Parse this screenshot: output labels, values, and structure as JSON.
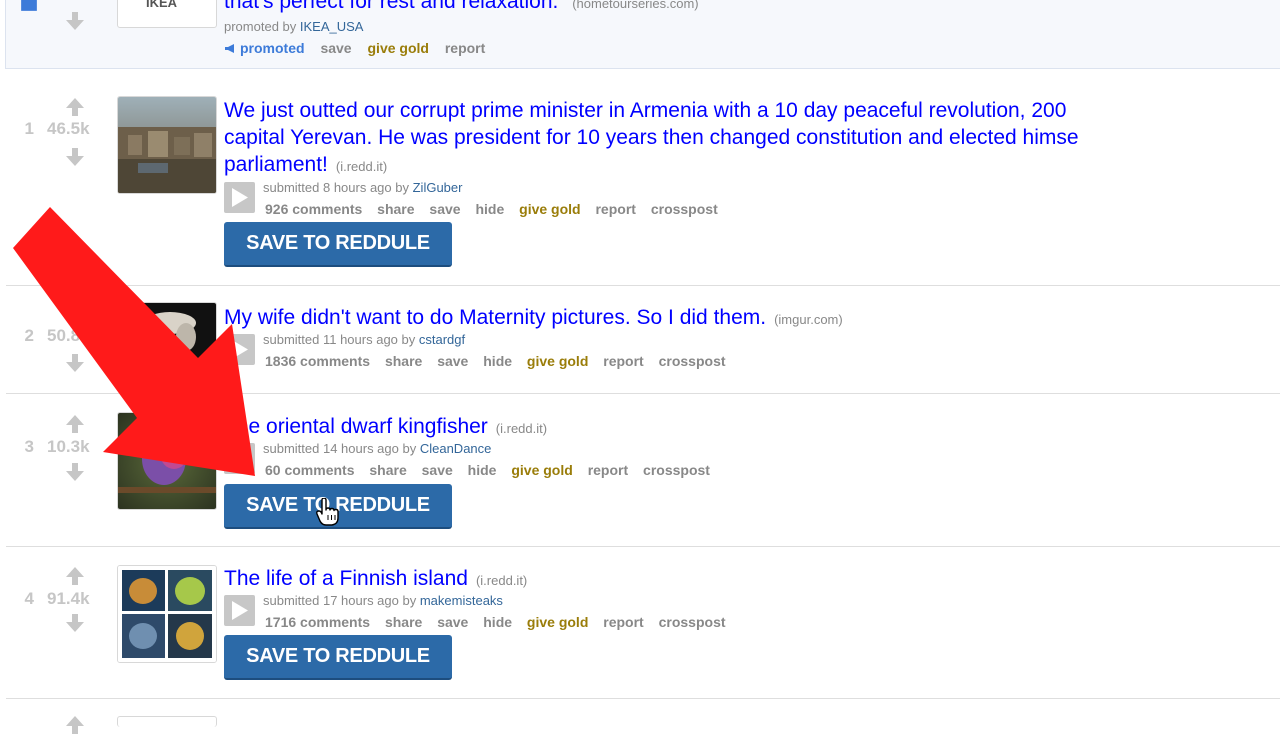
{
  "promoted_post": {
    "title_tail": "that's perfect for rest and relaxation.",
    "domain": "(hometourseries.com)",
    "promoted_by_prefix": "promoted by",
    "promoted_by_user": "IKEA_USA",
    "thumb_text": "IKEA",
    "buttons": {
      "promoted": "promoted",
      "save": "save",
      "give_gold": "give gold",
      "report": "report"
    }
  },
  "posts": [
    {
      "rank": "1",
      "score": "46.5k",
      "title_line1": "We just outted our corrupt prime minister in Armenia with a 10 day peaceful revolution, 200",
      "title_line2": "capital Yerevan. He was president for 10 years then changed constitution and elected himse",
      "title_line3": "parliament!",
      "domain": "(i.redd.it)",
      "submitted": "submitted 8 hours ago by",
      "user": "ZilGuber",
      "comments": "926 comments",
      "save_reddule": "SAVE TO REDDULE"
    },
    {
      "rank": "2",
      "score": "50.8k",
      "title": "My wife didn't want to do Maternity pictures. So I did them.",
      "domain": "(imgur.com)",
      "submitted": "submitted 11 hours ago by",
      "user": "cstardgf",
      "comments": "1836 comments"
    },
    {
      "rank": "3",
      "score": "10.3k",
      "title": "The oriental dwarf kingfisher",
      "domain": "(i.redd.it)",
      "submitted": "submitted 14 hours ago by",
      "user": "CleanDance",
      "comments": "60 comments",
      "save_reddule": "SAVE TO REDDULE"
    },
    {
      "rank": "4",
      "score": "91.4k",
      "title": "The life of a Finnish island",
      "domain": "(i.redd.it)",
      "submitted": "submitted 17 hours ago by",
      "user": "makemisteaks",
      "comments": "1716 comments",
      "save_reddule": "SAVE TO REDDULE"
    }
  ],
  "post_buttons": {
    "share": "share",
    "save": "save",
    "hide": "hide",
    "give_gold": "give gold",
    "report": "report",
    "crosspost": "crosspost"
  },
  "colors": {
    "link": "#0000ff",
    "reddule_button": "#2c6aa8",
    "annotation_arrow": "#ff1a1a",
    "gold": "#9a7d0a"
  },
  "icons": [
    "upvote-arrow-icon",
    "downvote-arrow-icon",
    "expando-play-icon",
    "megaphone-icon",
    "hand-cursor-icon",
    "red-arrow-annotation"
  ]
}
